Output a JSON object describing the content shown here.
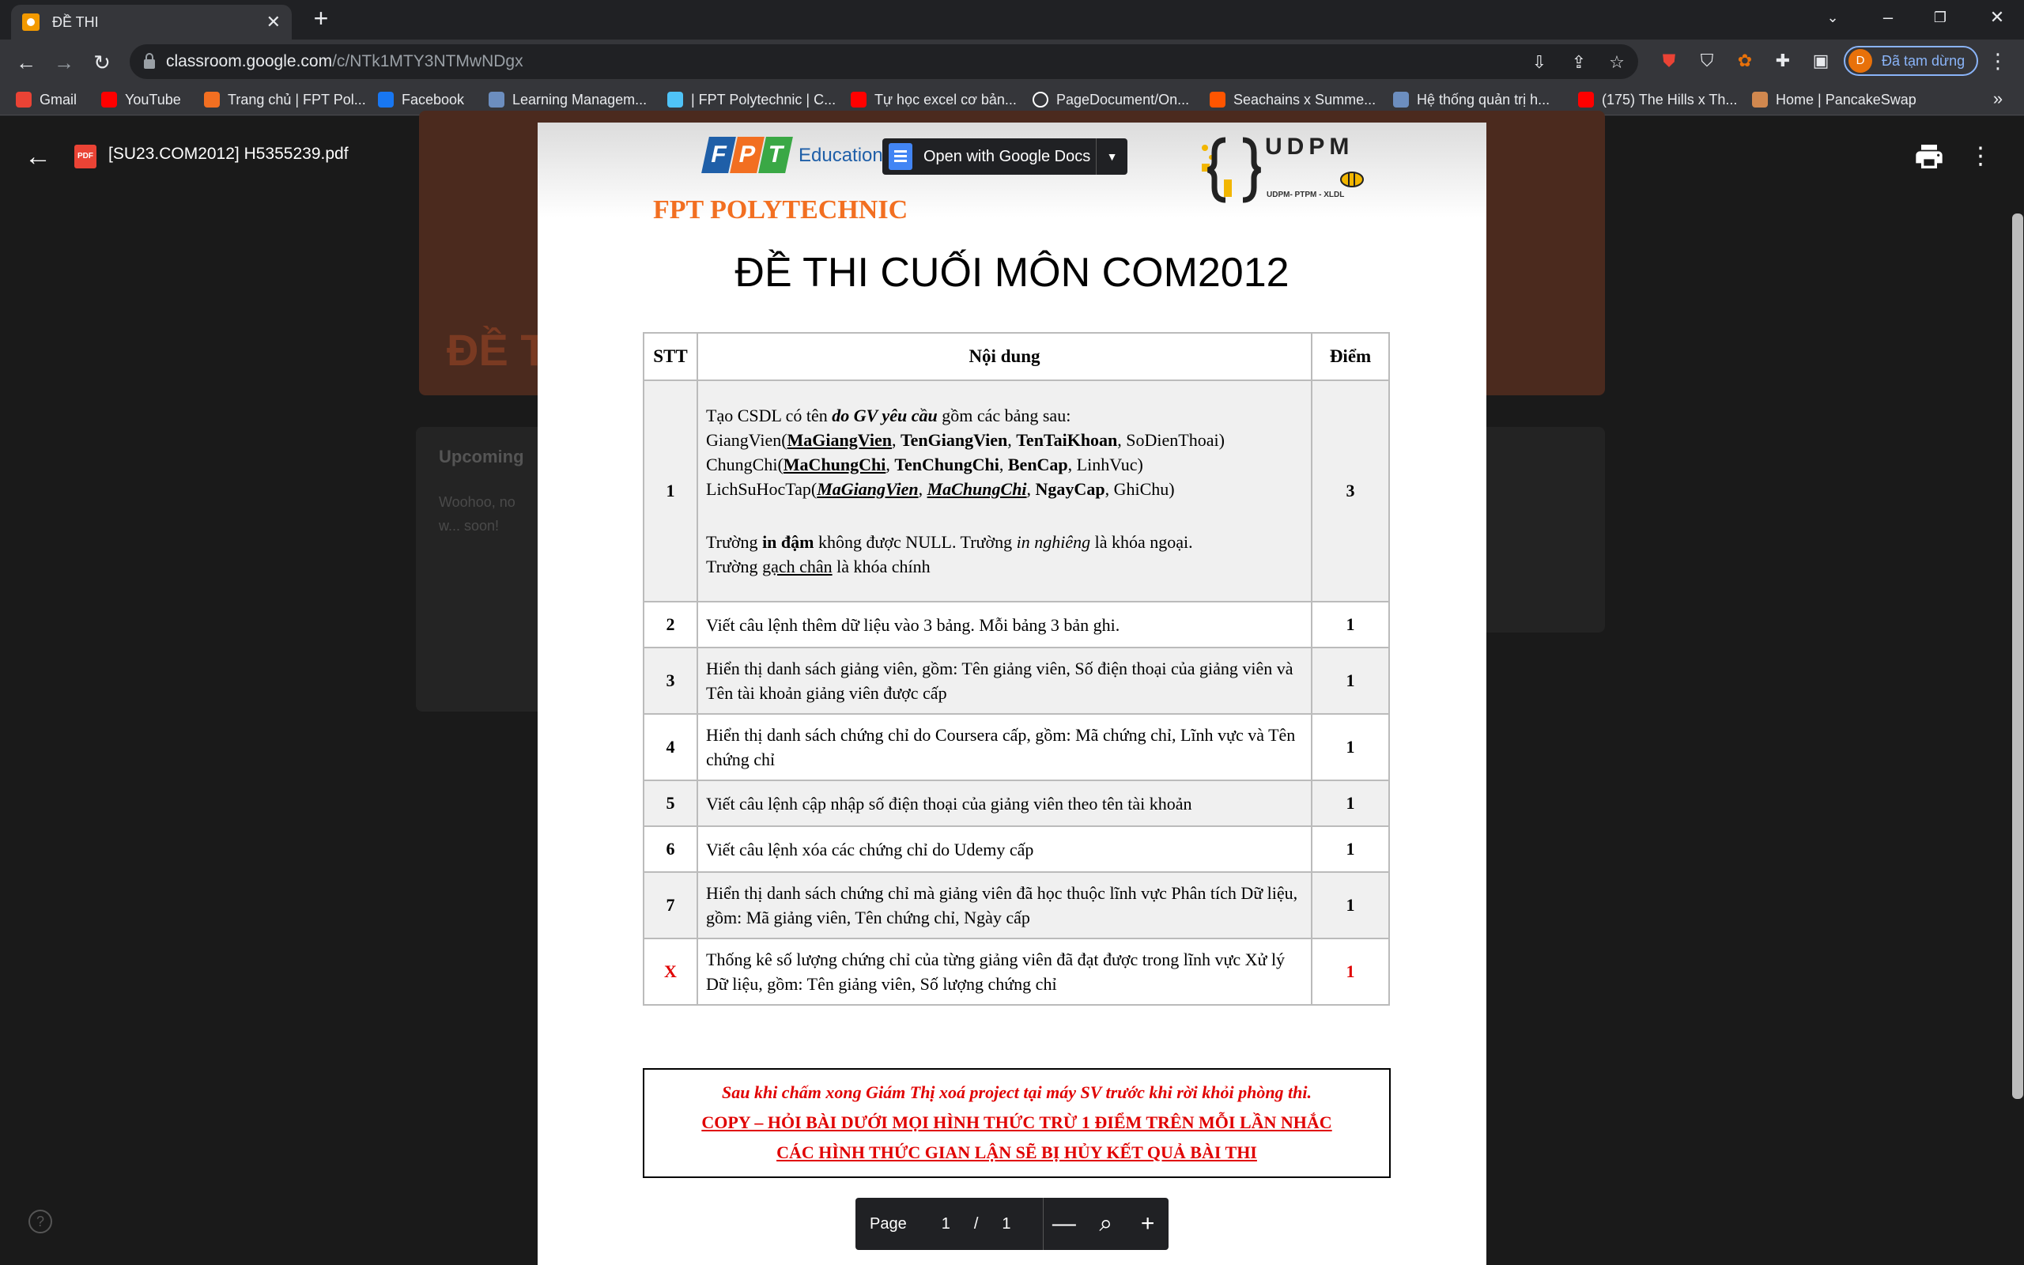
{
  "browser": {
    "tab_title": "ĐỀ THI",
    "url_host": "classroom.google.com",
    "url_path": "/c/NTk1MTY3NTMwNDgx",
    "profile_initial": "D",
    "profile_label": "Đã tạm dừng",
    "bookmarks": [
      {
        "label": "Gmail",
        "icon": "gmail-icon",
        "color": "#ea4335"
      },
      {
        "label": "YouTube",
        "icon": "youtube-icon",
        "color": "#ff0000"
      },
      {
        "label": "Trang chủ | FPT Pol...",
        "icon": "fpt-icon",
        "color": "#f26f21"
      },
      {
        "label": "Facebook",
        "icon": "facebook-icon",
        "color": "#1877f2"
      },
      {
        "label": "Learning Managem...",
        "icon": "lms-icon",
        "color": "#6c8ebf"
      },
      {
        "label": "| FPT Polytechnic | C...",
        "icon": "circle-icon",
        "color": "#4fc3f7"
      },
      {
        "label": "Tự học excel cơ bản...",
        "icon": "youtube-icon",
        "color": "#ff0000"
      },
      {
        "label": "PageDocument/On...",
        "icon": "github-icon",
        "color": "#ffffff"
      },
      {
        "label": "Seachains x Summe...",
        "icon": "soundcloud-icon",
        "color": "#ff5500"
      },
      {
        "label": "Hệ thống quản trị h...",
        "icon": "lms-icon",
        "color": "#6c8ebf"
      },
      {
        "label": "(175) The Hills x Th...",
        "icon": "youtube-icon",
        "color": "#ff0000"
      },
      {
        "label": "Home | PancakeSwap",
        "icon": "pancake-icon",
        "color": "#d1884f"
      }
    ]
  },
  "classroom_bg": {
    "banner_text": "ĐỀ T",
    "upcoming": "Upcoming",
    "woohoo": "Woohoo, no w... soon!"
  },
  "viewer": {
    "file_badge": "PDF",
    "file_name": "[SU23.COM2012] H5355239.pdf",
    "open_with": "Open with Google Docs"
  },
  "pdf": {
    "org_name": "FPT POLYTECHNIC",
    "education": "Education",
    "fpt_letters": [
      "F",
      "P",
      "T"
    ],
    "udpm_title": "UDPM",
    "udpm_sub": "UDPM- PTPM - XLDL",
    "title": "ĐỀ THI CUỐI MÔN COM2012",
    "headers": {
      "stt": "STT",
      "content": "Nội dung",
      "points": "Điểm"
    },
    "rows": [
      {
        "stt": "2",
        "content": "Viết câu lệnh thêm dữ liệu vào 3 bảng. Mỗi bảng 3 bản ghi.",
        "points": "1"
      },
      {
        "stt": "3",
        "content": "Hiển thị danh sách giảng viên, gồm: Tên giảng viên, Số điện thoại của giảng viên và Tên tài khoản giảng viên được cấp",
        "points": "1"
      },
      {
        "stt": "4",
        "content": "Hiển thị danh sách chứng chỉ do Coursera cấp, gồm: Mã chứng chỉ, Lĩnh vực và Tên chứng chỉ",
        "points": "1"
      },
      {
        "stt": "5",
        "content": "Viết câu lệnh cập nhập số điện thoại của giảng viên theo tên tài khoản",
        "points": "1"
      },
      {
        "stt": "6",
        "content": "Viết câu lệnh xóa các chứng chỉ do Udemy cấp",
        "points": "1"
      },
      {
        "stt": "7",
        "content": "Hiển thị danh sách chứng chỉ mà giảng viên đã học thuộc lĩnh vực Phân tích Dữ liệu, gồm: Mã giảng viên, Tên chứng chỉ, Ngày cấp",
        "points": "1"
      },
      {
        "stt": "X",
        "content": "Thống kê số lượng chứng chỉ của từng giảng viên đã đạt được trong lĩnh vực Xử lý Dữ liệu, gồm: Tên giảng viên, Số lượng chứng chỉ",
        "points": "1"
      }
    ],
    "row1": {
      "stt": "1",
      "points": "3",
      "intro_a": "Tạo CSDL có tên ",
      "intro_b": "do GV yêu cầu",
      "intro_c": " gồm các bảng sau:",
      "t1_name": "GiangVien(",
      "t1_pk": "MaGiangVien",
      "t1_b1": "TenGiangVien",
      "t1_b2": "TenTaiKhoan",
      "t1_tail": ", SoDienThoai)",
      "t2_name": "ChungChi(",
      "t2_pk": "MaChungChi",
      "t2_b1": "TenChungChi",
      "t2_b2": "BenCap",
      "t2_tail": ", LinhVuc)",
      "t3_name": "LichSuHocTap(",
      "t3_fk1": "MaGiangVien",
      "t3_fk2": "MaChungChi",
      "t3_b1": "NgayCap",
      "t3_tail": ", GhiChu)",
      "sep": ", ",
      "note1_a": "Trường ",
      "note1_b": "in đậm",
      "note1_c": " không được NULL. Trường ",
      "note1_d": "in nghiêng",
      "note1_e": " là khóa ngoại.",
      "note2_a": "Trường ",
      "note2_b": "gạch chân",
      "note2_c": " là khóa chính"
    },
    "warning": [
      "Sau khi chấm xong Giám Thị xoá project tại máy SV trước khi rời khỏi phòng thi.",
      "COPY – HỎI BÀI DƯỚI MỌI HÌNH THỨC TRỪ 1 ĐIỂM TRÊN MỖI LẦN NHẮC",
      "CÁC HÌNH THỨC GIAN LẬN SẼ BỊ HỦY KẾT QUẢ BÀI THI"
    ]
  },
  "page_control": {
    "label": "Page",
    "current": "1",
    "sep": "/",
    "total": "1"
  },
  "colors": {
    "fpt_blue": "#1f5fa8",
    "fpt_orange": "#f26f21",
    "fpt_green": "#3aa845",
    "warn_red": "#e00000"
  }
}
